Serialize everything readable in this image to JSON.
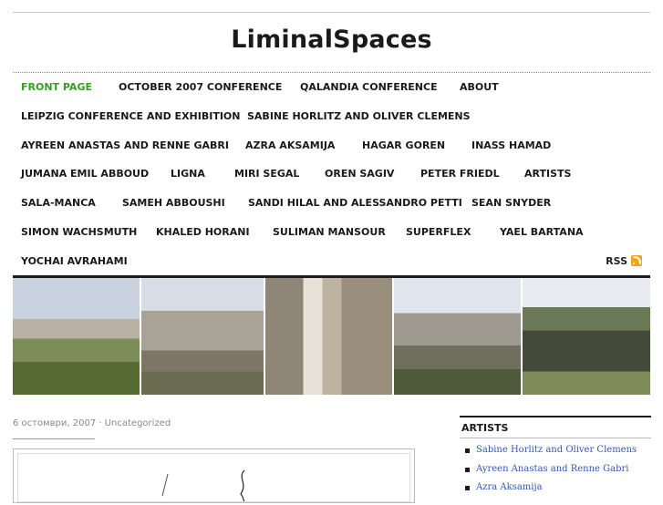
{
  "site": {
    "title": "LiminalSpaces"
  },
  "nav": {
    "rows": [
      [
        "FRONT PAGE",
        "OCTOBER 2007 CONFERENCE",
        "QALANDIA CONFERENCE",
        "ABOUT"
      ],
      [
        "LEIPZIG CONFERENCE AND EXHIBITION",
        "SABINE HORLITZ AND OLIVER CLEMENS"
      ],
      [
        "AYREEN ANASTAS AND RENNE GABRI",
        "AZRA AKSAMIJA",
        "HAGAR GOREN",
        "INASS HAMAD"
      ],
      [
        "JUMANA EMIL ABBOUD",
        "LIGNA",
        "MIRI SEGAL",
        "OREN SAGIV",
        "PETER FRIEDL",
        "ARTISTS"
      ],
      [
        "SALA-MANCA",
        "SAMEH ABBOUSHI",
        "SANDI HILAL AND ALESSANDRO PETTI",
        "SEAN SNYDER"
      ],
      [
        "SIMON WACHSMUTH",
        "KHALED HORANI",
        "SULIMAN MANSOUR",
        "SUPERFLEX",
        "YAEL BARTANA"
      ],
      [
        "YOCHAI AVRAHAMI"
      ]
    ],
    "active": "FRONT PAGE",
    "rss_label": "RSS",
    "active_color": "#34a021"
  },
  "header_images": [
    "hillside-with-cactus-photo",
    "hillside-town-photo",
    "alley-with-child-photo",
    "valley-town-photo",
    "crowd-in-field-photo"
  ],
  "post": {
    "meta": "6 остомври, 2007 · Uncategorized"
  },
  "sidebar": {
    "heading": "ARTISTS",
    "items": [
      "Sabine Horlitz and Oliver Clemens",
      "Ayreen Anastas and Renne Gabri",
      "Azra Aksamija"
    ],
    "link_color": "#3356b8"
  }
}
